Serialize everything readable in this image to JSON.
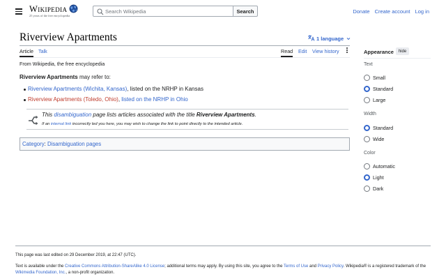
{
  "header": {
    "menu_icon": "hamburger-icon",
    "logo_icon": "wikipedia-globe-icon",
    "wordmark": "Wikipedia",
    "tagline": "25 years of the free encyclopedia",
    "search_placeholder": "Search Wikipedia",
    "search_icon": "search-icon",
    "search_button": "Search",
    "links": [
      "Donate",
      "Create account",
      "Log in"
    ]
  },
  "page": {
    "title": "Riverview Apartments",
    "language_icon": "translate-icon",
    "language_button": "1 language",
    "tabs_left": [
      "Article",
      "Talk"
    ],
    "tabs_right": [
      "Read",
      "Edit",
      "View history"
    ],
    "more_icon": "kebab-menu-icon"
  },
  "content": {
    "from": "From Wikipedia, the free encyclopedia",
    "intro_bold": "Riverview Apartments",
    "intro_rest": " may refer to:",
    "items": [
      {
        "link": "Riverview Apartments (Wichita, Kansas)",
        "link_color": "blue",
        "mid": ", listed on the NRHP in Kansas",
        "link2": ""
      },
      {
        "link": "Riverview Apartments (Toledo, Ohio)",
        "link_color": "red",
        "mid": ", ",
        "link2": "listed on the NRHP in Ohio"
      }
    ],
    "notice": {
      "icon": "disambiguation-icon",
      "pre": "This ",
      "link": "disambiguation",
      "mid": " page lists articles associated with the title ",
      "bold": "Riverview Apartments",
      "end": ".",
      "sub_pre": "If an ",
      "sub_link": "internal link",
      "sub_rest": " incorrectly led you here, you may wish to change the link to point directly to the intended article."
    },
    "categories": {
      "label": "Category",
      "sep": ":",
      "item": "Disambiguation pages"
    }
  },
  "appearance": {
    "title": "Appearance",
    "hide": "hide",
    "groups": [
      {
        "label": "Text",
        "options": [
          "Small",
          "Standard",
          "Large"
        ],
        "selected": "Standard"
      },
      {
        "label": "Width",
        "options": [
          "Standard",
          "Wide"
        ],
        "selected": "Standard"
      },
      {
        "label": "Color",
        "options": [
          "Automatic",
          "Light",
          "Dark"
        ],
        "selected": "Light"
      }
    ]
  },
  "footer": {
    "last_edited": "This page was last edited on 29 December 2019, at 22:47 (UTC).",
    "license_1": "Text is available under the ",
    "license_link": "Creative Commons Attribution-ShareAlike 4.0 License",
    "license_2": "; additional terms may apply. By using this site, you agree to the ",
    "terms_link": "Terms of Use",
    "and": " and ",
    "privacy_link": "Privacy Policy",
    "license_3": ". Wikipedia® is a registered trademark of the ",
    "foundation_link": "Wikimedia Foundation, Inc.",
    "license_4": ", a non-profit organization."
  },
  "colors": {
    "link": "#3366cc",
    "redlink": "#bf3c2c",
    "text": "#202122",
    "border": "#a2a9b1"
  }
}
